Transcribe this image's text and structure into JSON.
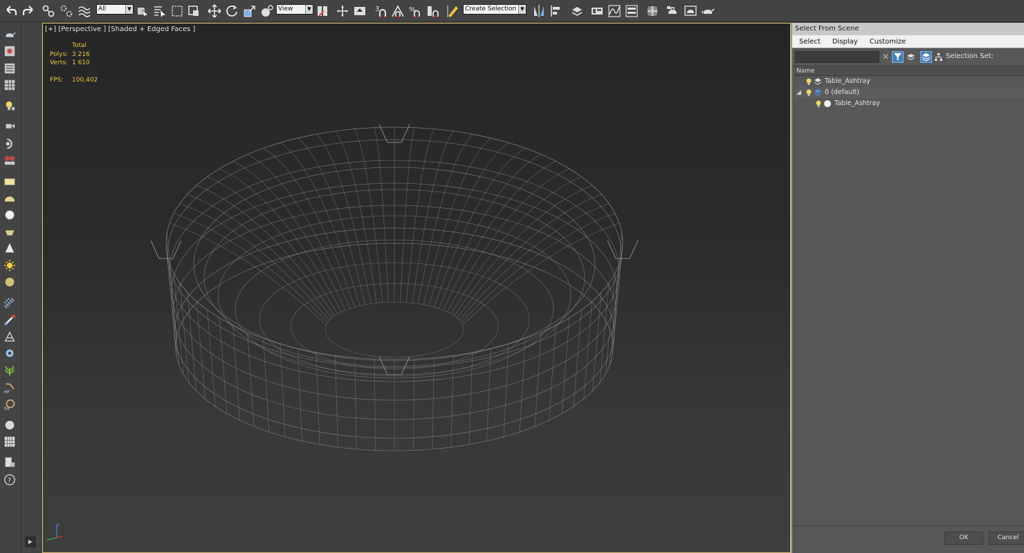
{
  "toolbar": {
    "selection_filter": "All",
    "reference_coord": "View",
    "named_selection_set": "Create Selection Se",
    "snap_3d": "3",
    "percent_snap": "%"
  },
  "viewport": {
    "label": "[+] [Perspective ] [Shaded + Edged Faces ]",
    "stats": {
      "header": "Total",
      "polys_label": "Polys:",
      "polys_value": "3 216",
      "verts_label": "Verts:",
      "verts_value": "1 610",
      "fps_label": "FPS:",
      "fps_value": "100,402"
    },
    "axis_label": "z",
    "wire_color": "#9a9a9a"
  },
  "explorer": {
    "title": "Select From Scene",
    "menu": [
      "Select",
      "Display",
      "Customize"
    ],
    "search_value": "",
    "selection_set_label": "Selection Set:",
    "column_name": "Name",
    "tree": [
      {
        "label": "Table_Ashtray",
        "type": "layer-object"
      },
      {
        "label": "0 (default)",
        "type": "layer"
      },
      {
        "label": "Table_Ashtray",
        "type": "object"
      }
    ],
    "ok_label": "OK",
    "cancel_label": "Cancel",
    "accent": "#4b7fb2"
  },
  "icons": {
    "undo": "undo-icon",
    "redo": "redo-icon",
    "link": "link-icon",
    "unlink": "unlink-icon",
    "bind": "bind-spacewarp-icon",
    "select": "select-object-icon",
    "select_by_name": "select-by-name-icon",
    "region": "rect-selection-icon",
    "window_crossing": "window-crossing-icon",
    "move": "move-icon",
    "rotate": "rotate-icon",
    "scale": "scale-icon",
    "placement": "placement-icon",
    "use_pivot": "use-pivot-icon",
    "manipulate": "manipulate-icon",
    "keyboard_shortcut": "keyboard-shortcut-icon",
    "snap": "snap-toggle-icon",
    "angle_snap": "angle-snap-icon",
    "percent_snap": "percent-snap-icon",
    "spinner_snap": "spinner-snap-icon",
    "edit_named_sets": "edit-named-sets-icon",
    "mirror": "mirror-icon",
    "align": "align-icon",
    "layers": "layer-manager-icon",
    "ribbon": "ribbon-icon",
    "curve_editor": "curve-editor-icon",
    "schematic": "schematic-view-icon",
    "material_editor": "material-editor-icon",
    "render_setup": "render-setup-icon",
    "render_frame": "rendered-frame-icon",
    "render": "render-teapot-icon"
  }
}
